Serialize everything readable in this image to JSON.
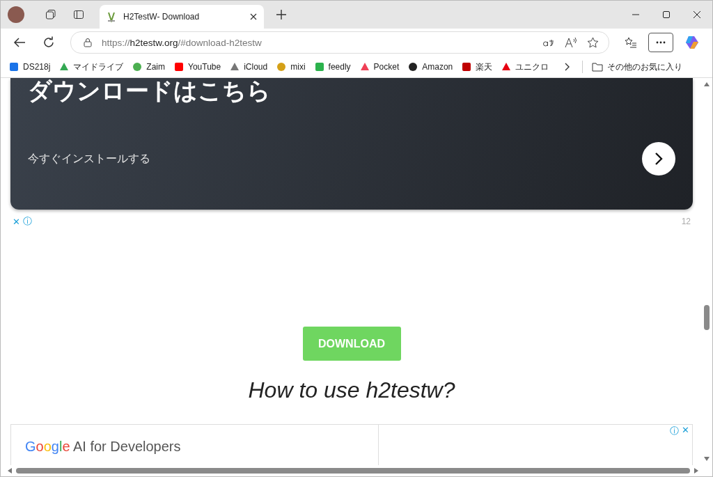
{
  "browser": {
    "tabs": [
      {
        "title": "H2TestW- Download",
        "selected": true
      }
    ],
    "address": {
      "scheme": "https://",
      "host": "h2testw.org",
      "path": "/#download-h2testw"
    },
    "bookmarks": [
      {
        "label": "DS218j"
      },
      {
        "label": "マイドライブ"
      },
      {
        "label": "Zaim"
      },
      {
        "label": "YouTube"
      },
      {
        "label": "iCloud"
      },
      {
        "label": "mixi"
      },
      {
        "label": "feedly"
      },
      {
        "label": "Pocket"
      },
      {
        "label": "Amazon"
      },
      {
        "label": "楽天"
      },
      {
        "label": "ユニクロ"
      }
    ],
    "other_bookmarks": "その他のお気に入り"
  },
  "page": {
    "banner": {
      "title": "ダウンロードはこちら",
      "subtitle": "今すぐインストールする"
    },
    "ad_controls": {
      "close": "✕",
      "info": "ⓘ",
      "count": "12"
    },
    "download_button": "DOWNLOAD",
    "heading": "How to use h2testw?",
    "ad": {
      "brand": "Google",
      "text": "AI for Developers",
      "info": "ⓘ",
      "close": "✕"
    }
  }
}
